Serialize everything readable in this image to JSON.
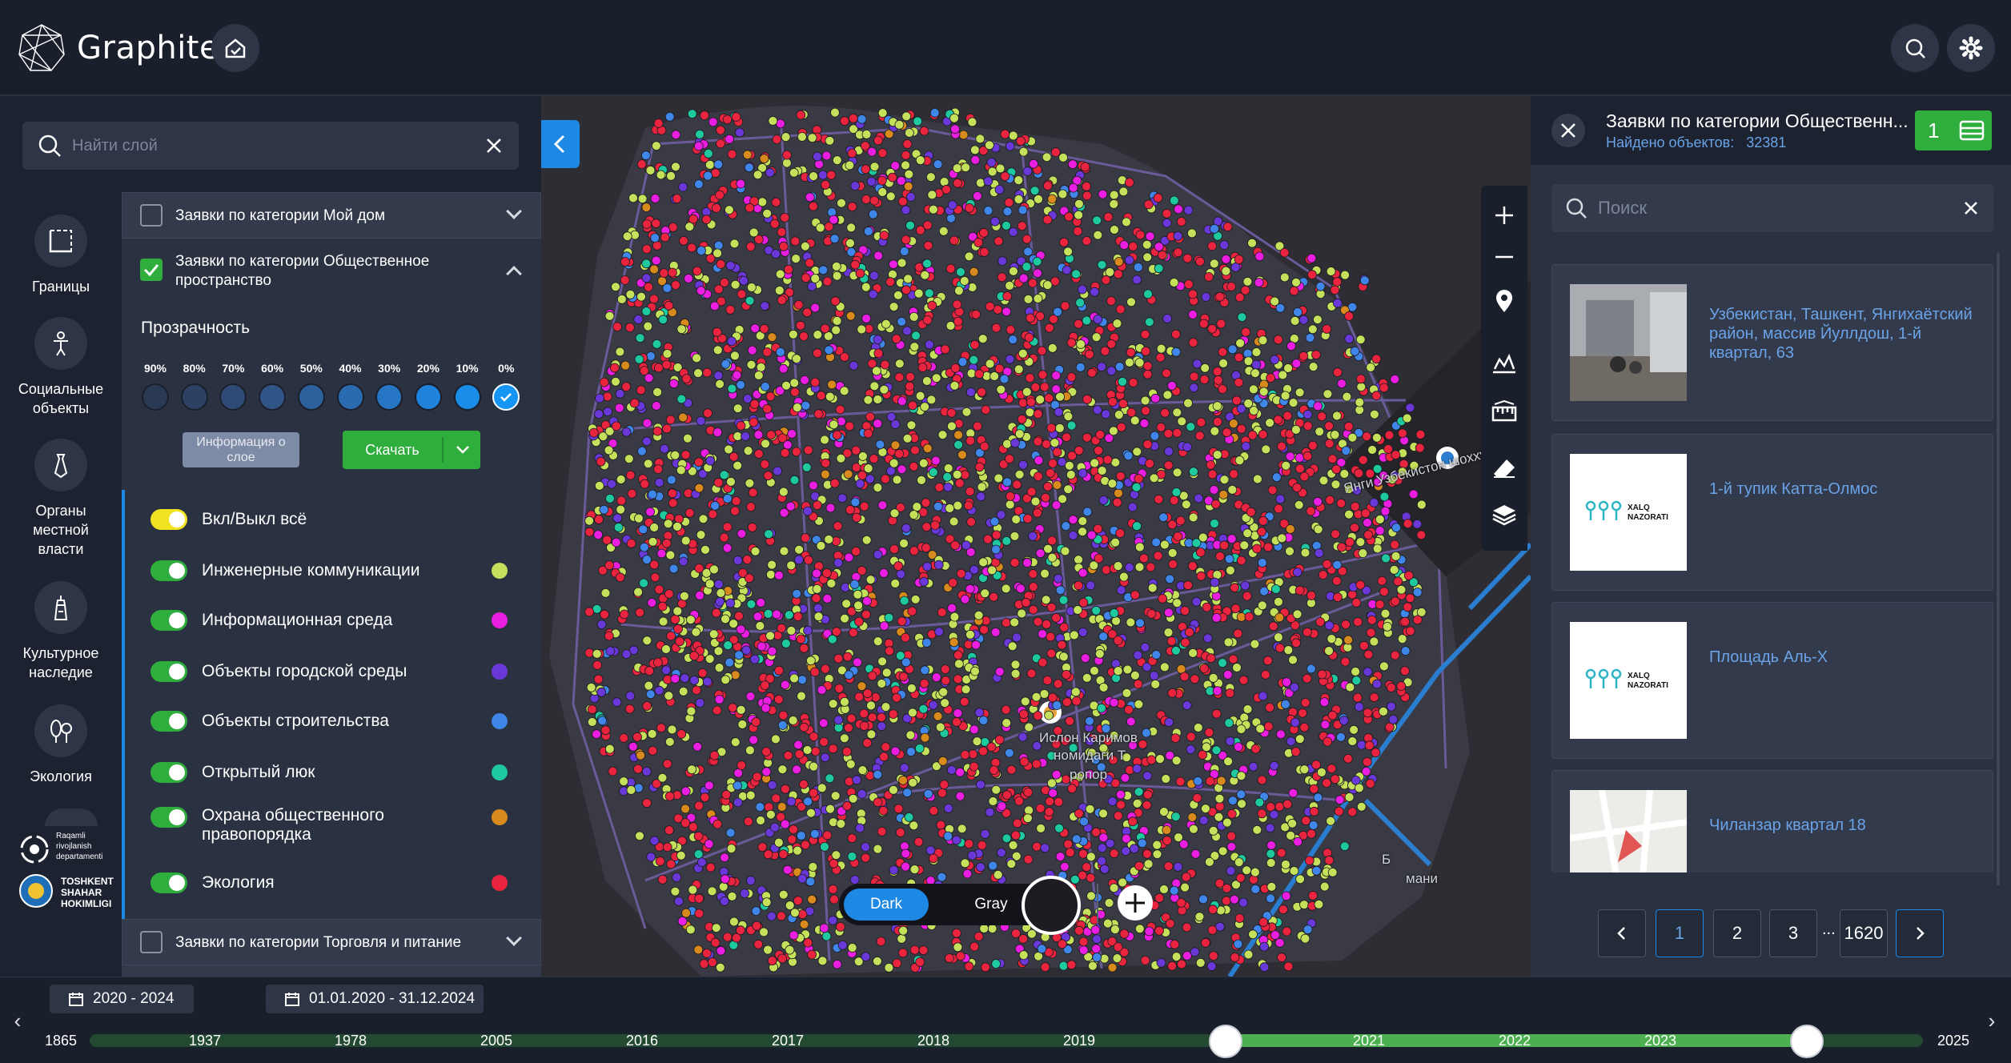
{
  "app": {
    "name": "Graphite"
  },
  "layer_search": {
    "placeholder": "Найти слой"
  },
  "rail": [
    {
      "label": "Границы",
      "icon": "boundary-icon"
    },
    {
      "label": "Социальные объекты",
      "icon": "person-icon"
    },
    {
      "label": "Органы местной власти",
      "icon": "tie-icon"
    },
    {
      "label": "Культурное наследие",
      "icon": "tower-icon"
    },
    {
      "label": "Экология",
      "icon": "leaf-icon"
    }
  ],
  "footer_logos": [
    {
      "line1": "Raqamli",
      "line2": "rivojlanish",
      "line3": "departamenti"
    },
    {
      "line1": "TOSHKENT",
      "line2": "SHAHAR",
      "line3": "HOKIMLIGI"
    }
  ],
  "layers": {
    "my_home": {
      "title": "Заявки по категории Мой дом",
      "checked": false
    },
    "public_space": {
      "title": "Заявки по категории Общественное пространство",
      "checked": true
    },
    "trade": {
      "title": "Заявки по категории Торговля и питание",
      "checked": false
    }
  },
  "opacity": {
    "label": "Прозрачность",
    "levels": [
      "90%",
      "80%",
      "70%",
      "60%",
      "50%",
      "40%",
      "30%",
      "20%",
      "10%",
      "0%"
    ],
    "selected": "0%"
  },
  "buttons": {
    "info": "Информация о слое",
    "download": "Скачать"
  },
  "toggle_all": {
    "label": "Вкл/Выкл всё",
    "on": true
  },
  "categories": [
    {
      "label": "Инженерные коммуникации",
      "color": "#c5e05a",
      "on": true
    },
    {
      "label": "Информационная среда",
      "color": "#e91ee0",
      "on": true
    },
    {
      "label": "Объекты городской среды",
      "color": "#6a38d8",
      "on": true
    },
    {
      "label": "Объекты строительства",
      "color": "#3f86e8",
      "on": true
    },
    {
      "label": "Открытый люк",
      "color": "#1fc9a0",
      "on": true
    },
    {
      "label": "Охрана общественного правопорядка",
      "color": "#d98a1c",
      "on": true
    },
    {
      "label": "Экология",
      "color": "#e8243f",
      "on": true
    }
  ],
  "map": {
    "basemap_options": [
      "Dark",
      "Gray"
    ],
    "basemap_selected": "Dark",
    "labels": {
      "road": "Янги Узбекистон шоххуч",
      "place1": "Ислон Каримов",
      "place2": "номидаги Т",
      "place3": "ропор",
      "place4": "Б",
      "place5": "мани"
    },
    "tools": [
      "plus-icon",
      "minus-icon",
      "location-pin-icon",
      "terrain-icon",
      "ruler-icon",
      "eraser-icon",
      "layers-icon"
    ]
  },
  "results": {
    "title": "Заявки по категории Общественн...",
    "found_label": "Найдено объектов:",
    "found_count": "32381",
    "selected_count": "1",
    "search_placeholder": "Поиск",
    "items": [
      {
        "text": "Узбекистан, Ташкент, Янгихаётский район, массив Йуллдош, 1-й квартал, 63",
        "thumb": "photo"
      },
      {
        "text": "1-й тупик Катта-Олмос",
        "thumb": "xalq"
      },
      {
        "text": "Площадь Аль-Х",
        "thumb": "xalq"
      },
      {
        "text": "Чиланзар квартал 18",
        "thumb": "map"
      }
    ],
    "thumb_logo": {
      "line1": "XALQ",
      "line2": "NAZORATI"
    },
    "pagination": [
      "1",
      "2",
      "3",
      "...",
      "1620"
    ],
    "current_page": "1"
  },
  "timeline": {
    "years_range": "2020 - 2024",
    "date_range": "01.01.2020 - 31.12.2024",
    "ticks": [
      "1865",
      "1937",
      "1978",
      "2005",
      "2016",
      "2017",
      "2018",
      "2019",
      "2021",
      "2022",
      "2023",
      "2025"
    ]
  }
}
